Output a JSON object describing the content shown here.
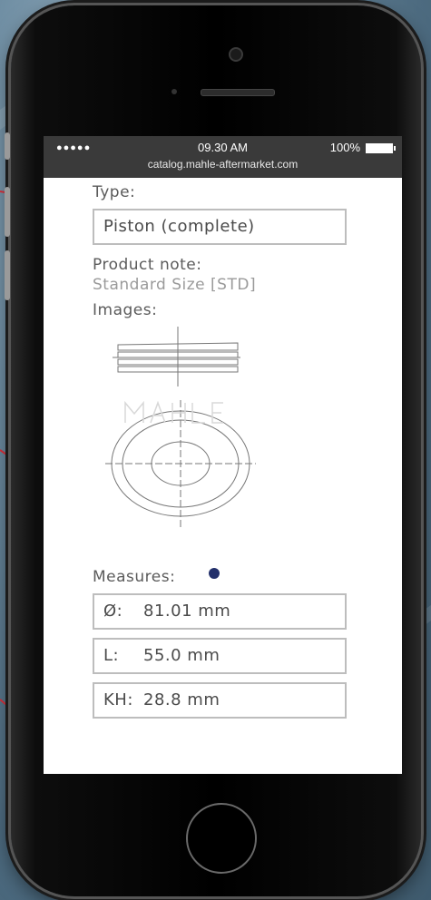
{
  "status_bar": {
    "signal": "●●●●●",
    "time": "09.30 AM",
    "battery": "100%",
    "url": "catalog.mahle-aftermarket.com"
  },
  "product": {
    "type_label": "Type:",
    "type_value": "Piston (complete)",
    "note_label": "Product note:",
    "note_value": "Standard Size [STD]",
    "images_label": "Images:",
    "measures_label": "Measures:",
    "measures": [
      {
        "key": "Ø:",
        "value": "81.01 mm"
      },
      {
        "key": "L:",
        "value": "55.0 mm"
      },
      {
        "key": "KH:",
        "value": "28.8 mm"
      }
    ]
  },
  "colors": {
    "status_bar": "#3a3a3a",
    "carousel_dot": "#23306b",
    "field_border": "#bdbdbd"
  }
}
